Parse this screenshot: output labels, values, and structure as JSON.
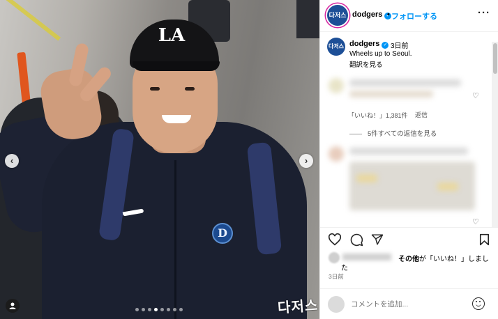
{
  "post": {
    "photo_watermark": "다저스",
    "carousel_dots": 8,
    "carousel_active_index": 3,
    "nav_prev": "‹",
    "nav_next": "›"
  },
  "header": {
    "account_name": "dodgers",
    "separator": "•",
    "follow_label": "フォローする",
    "more_label": "···",
    "avatar_text": "다저스"
  },
  "caption": {
    "account_name": "dodgers",
    "time": "3日前",
    "text": "Wheels up to Seoul.",
    "translate_label": "翻訳を見る",
    "avatar_text": "다저스"
  },
  "comments": {
    "likes_count": "「いいね！」1,381件",
    "reply_label": "返信",
    "view_replies_label": "5件すべての返信を見る"
  },
  "likes": {
    "text_bold": "その他",
    "text_rest": "が「いいね！」しまし",
    "text_wrap": "た"
  },
  "post_time": "3日前",
  "comment_input": {
    "placeholder": "コメントを追加..."
  },
  "colors": {
    "accent": "#0095f6",
    "dodgers_blue": "#1d4f97"
  }
}
